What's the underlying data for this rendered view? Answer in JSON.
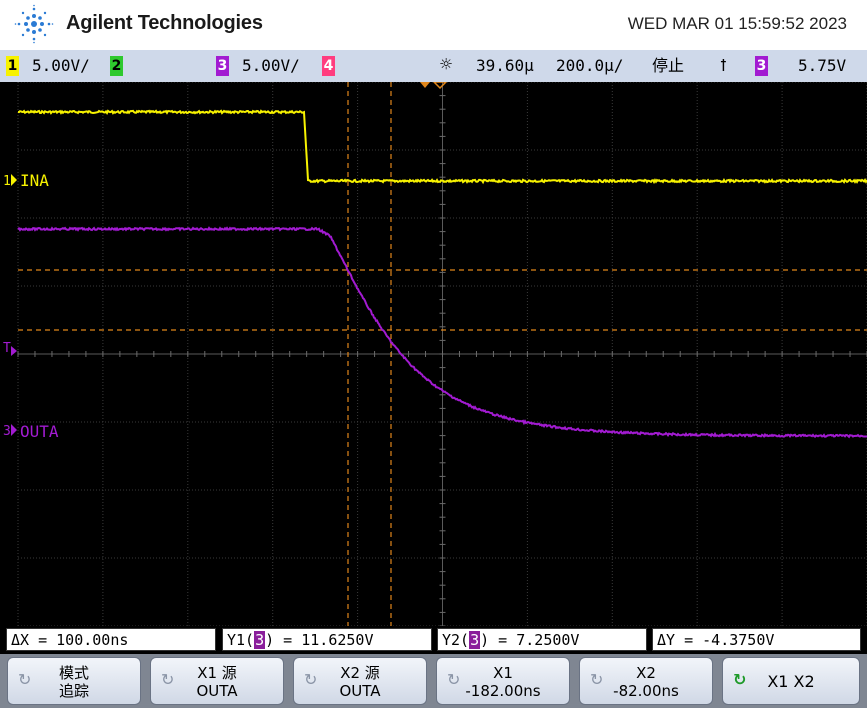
{
  "header": {
    "brand": "Agilent Technologies",
    "datetime": "WED MAR 01 15:59:52 2023"
  },
  "status": {
    "ch1_num": "1",
    "ch1_scale": "5.00V/",
    "ch2_num": "2",
    "ch3_num": "3",
    "ch3_scale": "5.00V/",
    "ch4_num": "4",
    "trigger_icon": "☼",
    "delay": "39.60µ",
    "timebase": "200.0µ/",
    "run_state": "停止",
    "trigger_slope": "ꝉ",
    "trig_source_num": "3",
    "trigger_level": "5.75V"
  },
  "colors": {
    "ch1": "#f7f200",
    "ch2": "#2ec92e",
    "ch3": "#a21bd1",
    "ch4": "#ff3d7f",
    "cursor": "#e0861b"
  },
  "channels": {
    "ch1_marker": "1",
    "ch1_label": "INA",
    "ch3_marker": "3",
    "ch3_label": "OUTA",
    "trigger_marker": "T"
  },
  "measurements": {
    "dx": "ΔX = 100.00ns",
    "y1_prefix": "Y1(",
    "y1_ch": "3",
    "y1_suffix": ") = 11.6250V",
    "y2_prefix": "Y2(",
    "y2_ch": "3",
    "y2_suffix": ") = 7.2500V",
    "dy": "ΔY = -4.3750V"
  },
  "softkeys": [
    {
      "line1": "模式",
      "line2": "追踪"
    },
    {
      "line1": "X1 源",
      "line2": "OUTA"
    },
    {
      "line1": "X2 源",
      "line2": "OUTA"
    },
    {
      "line1": "X1",
      "line2": "-182.00ns"
    },
    {
      "line1": "X2",
      "line2": "-82.00ns"
    },
    {
      "label": "X1 X2"
    }
  ],
  "icons": {
    "softkey_arrow": "rotate-arrow-icon",
    "softkey_active": "rotate-arrow-active-icon",
    "logo": "agilent-spark-logo"
  }
}
